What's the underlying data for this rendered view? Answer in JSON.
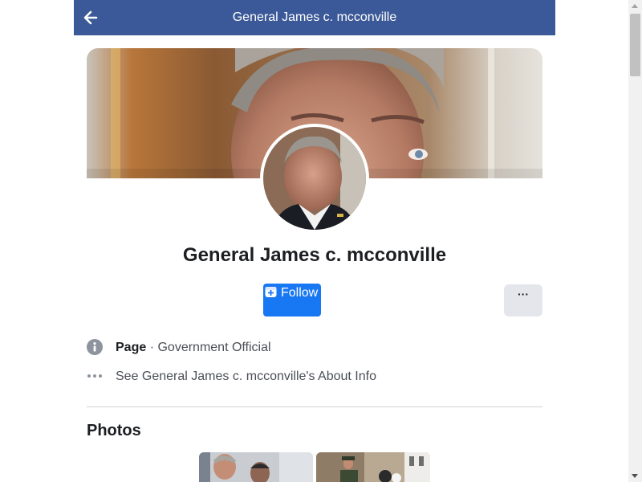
{
  "header": {
    "title": "General James c. mcconville",
    "back_icon": "arrow-left-icon",
    "background": "#3b5998"
  },
  "profile": {
    "name": "General James c. mcconville"
  },
  "actions": {
    "follow_label": "Follow",
    "follow_icon": "follow-plus-icon",
    "follow_color": "#1877f2",
    "more_label": "···",
    "more_icon": "more-dots-icon"
  },
  "info": {
    "type_label": "Page",
    "separator": " · ",
    "category": "Government Official",
    "info_icon": "info-circle-icon",
    "about_text": "See General James c. mcconville's About Info",
    "about_icon": "ellipsis-icon"
  },
  "photos": {
    "title": "Photos",
    "items": [
      "photo-1",
      "photo-2"
    ]
  }
}
